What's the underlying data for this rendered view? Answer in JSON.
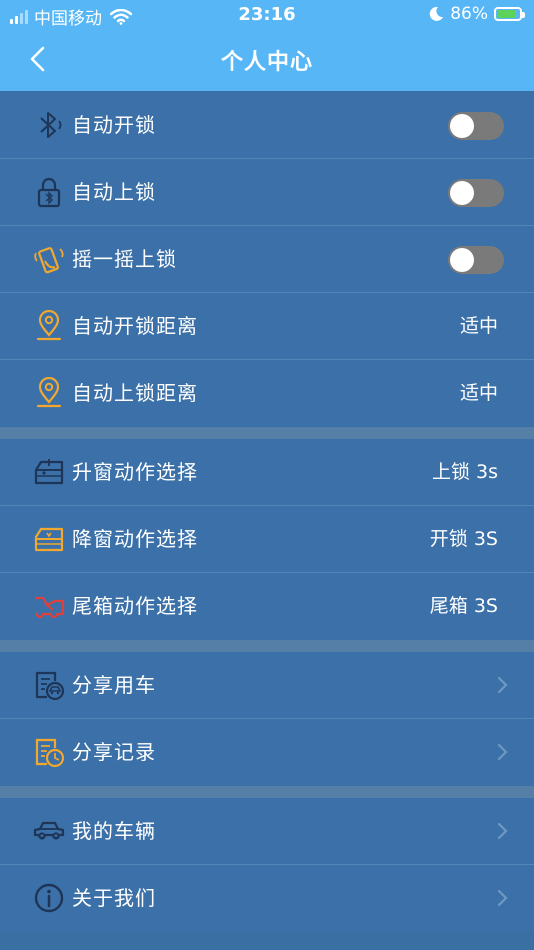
{
  "status_bar": {
    "carrier": "中国移动",
    "time": "23:16",
    "battery_percent": "86%"
  },
  "header": {
    "title": "个人中心"
  },
  "groups": [
    {
      "items": [
        {
          "label": "自动开锁",
          "icon": "bluetooth-icon",
          "control": "toggle",
          "on": false
        },
        {
          "label": "自动上锁",
          "icon": "bluetooth-lock-icon",
          "control": "toggle",
          "on": false
        },
        {
          "label": "摇一摇上锁",
          "icon": "shake-phone-icon",
          "control": "toggle",
          "on": false
        },
        {
          "label": "自动开锁距离",
          "icon": "location-pin-icon",
          "value": "适中"
        },
        {
          "label": "自动上锁距离",
          "icon": "location-pin-icon",
          "value": "适中"
        }
      ]
    },
    {
      "items": [
        {
          "label": "升窗动作选择",
          "icon": "window-up-icon",
          "value": "上锁 3s"
        },
        {
          "label": "降窗动作选择",
          "icon": "window-down-icon",
          "value": "开锁 3S"
        },
        {
          "label": "尾箱动作选择",
          "icon": "trunk-icon",
          "value": "尾箱 3S"
        }
      ]
    },
    {
      "items": [
        {
          "label": "分享用车",
          "icon": "share-car-icon"
        },
        {
          "label": "分享记录",
          "icon": "share-record-icon"
        }
      ]
    },
    {
      "items": [
        {
          "label": "我的车辆",
          "icon": "car-icon"
        },
        {
          "label": "关于我们",
          "icon": "info-icon"
        }
      ]
    }
  ],
  "colors": {
    "header_bg": "#56b6f6",
    "list_bg": "#3b70a8",
    "icon_dark": "#1e3557",
    "icon_orange": "#f0a830",
    "icon_red": "#e0403a",
    "toggle_off": "#7a7a7a"
  }
}
